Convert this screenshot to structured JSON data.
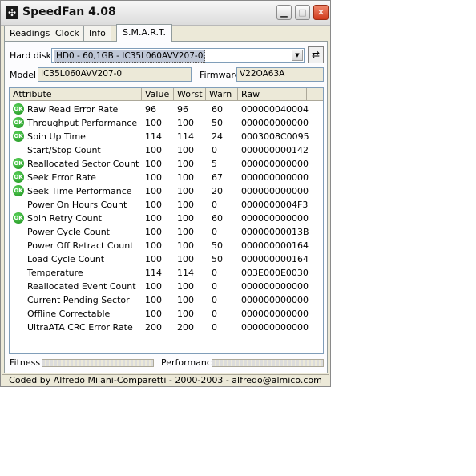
{
  "window": {
    "title": "SpeedFan 4.08"
  },
  "tabs": [
    {
      "label": "Readings",
      "active": false
    },
    {
      "label": "Clock",
      "active": false
    },
    {
      "label": "Info",
      "active": false
    },
    {
      "label": "S.M.A.R.T.",
      "active": true
    }
  ],
  "smart": {
    "harddisk_label": "Hard disk",
    "harddisk_value": "HD0 - 60,1GB - IC35L060AVV207-0",
    "model_label": "Model",
    "model_value": "IC35L060AVV207-0",
    "firmware_label": "Firmware",
    "firmware_value": "V22OA63A",
    "columns": [
      "Attribute",
      "Value",
      "Worst",
      "Warn",
      "Raw"
    ],
    "ok_badge": "OK",
    "rows": [
      {
        "attribute": "Raw Read Error Rate",
        "value": "96",
        "worst": "96",
        "warn": "60",
        "raw": "000000040004",
        "ok": true
      },
      {
        "attribute": "Throughput Performance",
        "value": "100",
        "worst": "100",
        "warn": "50",
        "raw": "000000000000",
        "ok": true
      },
      {
        "attribute": "Spin Up Time",
        "value": "114",
        "worst": "114",
        "warn": "24",
        "raw": "0003008C0095",
        "ok": true
      },
      {
        "attribute": "Start/Stop Count",
        "value": "100",
        "worst": "100",
        "warn": "0",
        "raw": "000000000142",
        "ok": false
      },
      {
        "attribute": "Reallocated Sector Count",
        "value": "100",
        "worst": "100",
        "warn": "5",
        "raw": "000000000000",
        "ok": true
      },
      {
        "attribute": "Seek Error Rate",
        "value": "100",
        "worst": "100",
        "warn": "67",
        "raw": "000000000000",
        "ok": true
      },
      {
        "attribute": "Seek Time Performance",
        "value": "100",
        "worst": "100",
        "warn": "20",
        "raw": "000000000000",
        "ok": true
      },
      {
        "attribute": "Power On Hours Count",
        "value": "100",
        "worst": "100",
        "warn": "0",
        "raw": "0000000004F3",
        "ok": false
      },
      {
        "attribute": "Spin Retry Count",
        "value": "100",
        "worst": "100",
        "warn": "60",
        "raw": "000000000000",
        "ok": true
      },
      {
        "attribute": "Power Cycle Count",
        "value": "100",
        "worst": "100",
        "warn": "0",
        "raw": "00000000013B",
        "ok": false
      },
      {
        "attribute": "Power Off Retract Count",
        "value": "100",
        "worst": "100",
        "warn": "50",
        "raw": "000000000164",
        "ok": false
      },
      {
        "attribute": "Load Cycle Count",
        "value": "100",
        "worst": "100",
        "warn": "50",
        "raw": "000000000164",
        "ok": false
      },
      {
        "attribute": "Temperature",
        "value": "114",
        "worst": "114",
        "warn": "0",
        "raw": "003E000E0030",
        "ok": false
      },
      {
        "attribute": "Reallocated Event Count",
        "value": "100",
        "worst": "100",
        "warn": "0",
        "raw": "000000000000",
        "ok": false
      },
      {
        "attribute": "Current Pending Sector",
        "value": "100",
        "worst": "100",
        "warn": "0",
        "raw": "000000000000",
        "ok": false
      },
      {
        "attribute": "Offline Correctable",
        "value": "100",
        "worst": "100",
        "warn": "0",
        "raw": "000000000000",
        "ok": false
      },
      {
        "attribute": "UltraATA CRC Error Rate",
        "value": "200",
        "worst": "200",
        "warn": "0",
        "raw": "000000000000",
        "ok": false
      }
    ],
    "fitness_label": "Fitness",
    "performance_label": "Performance"
  },
  "status": {
    "text": "Coded by Alfredo Milani-Comparetti - 2000-2003 - alfredo@almico.com"
  },
  "colors": {
    "ok_green": "#1b8c1b",
    "close_red": "#d0391b",
    "window_bg": "#ece9d8"
  }
}
